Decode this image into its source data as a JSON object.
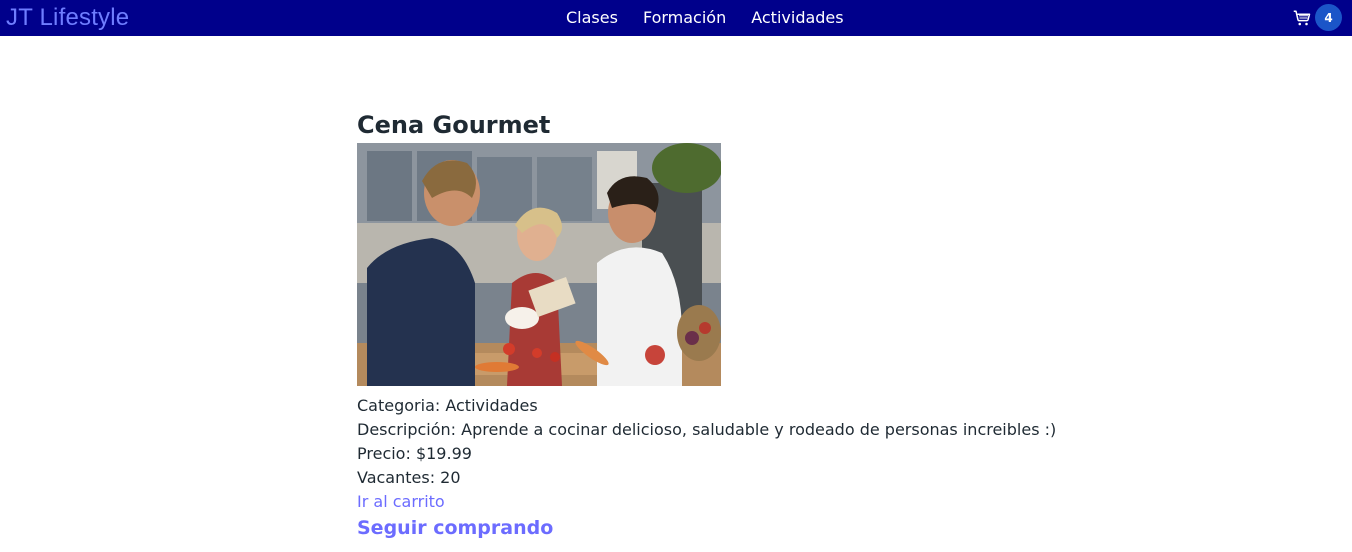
{
  "navbar": {
    "brand": "JT Lifestyle",
    "links": [
      "Clases",
      "Formación",
      "Actividades"
    ],
    "cart_icon": "cart-icon",
    "cart_count": "4",
    "colors": {
      "background": "#00008b",
      "brand": "#6f7dff",
      "badge": "#1b55c8"
    }
  },
  "product": {
    "title": "Cena Gourmet",
    "image_icon": "photo-cooking-scene",
    "categoria": "Categoria: Actividades",
    "descripcion": "Descripción: Aprende a cocinar delicioso, saludable y rodeado de personas increibles :)",
    "precio": "Precio: $19.99",
    "vacantes": "Vacantes: 20",
    "go_to_cart": "Ir al carrito",
    "continue_shopping": "Seguir comprando",
    "link_color": "#6c6cff"
  }
}
